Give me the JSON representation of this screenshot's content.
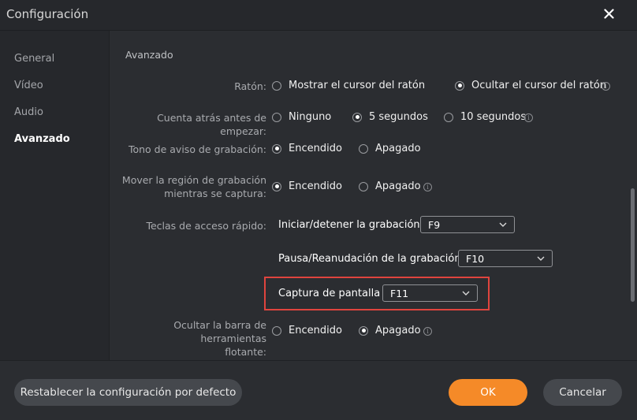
{
  "window": {
    "title": "Configuración"
  },
  "sidebar": {
    "items": [
      {
        "label": "General"
      },
      {
        "label": "Vídeo"
      },
      {
        "label": "Audio"
      },
      {
        "label": "Avanzado"
      }
    ],
    "active": "Avanzado"
  },
  "section": {
    "title": "Avanzado"
  },
  "settings": {
    "mouse": {
      "label": "Ratón:",
      "options": [
        "Mostrar el cursor del ratón",
        "Ocultar el cursor del ratón"
      ],
      "selected": "Ocultar el cursor del ratón"
    },
    "countdown": {
      "label": "Cuenta atrás antes de empezar:",
      "options": [
        "Ninguno",
        "5 segundos",
        "10 segundos"
      ],
      "selected": "5 segundos"
    },
    "beep": {
      "label": "Tono de aviso de grabación:",
      "options": [
        "Encendido",
        "Apagado"
      ],
      "selected": "Encendido"
    },
    "move_region": {
      "label_line1": "Mover la región de grabación",
      "label_line2": "mientras se captura:",
      "options": [
        "Encendido",
        "Apagado"
      ],
      "selected": "Encendido"
    },
    "hotkeys": {
      "label": "Teclas de acceso rápido:",
      "start_stop": {
        "label": "Iniciar/detener la grabación",
        "value": "F9"
      },
      "pause_resume": {
        "label": "Pausa/Reanudación de la grabación",
        "value": "F10"
      },
      "screenshot": {
        "label": "Captura de pantalla",
        "value": "F11"
      }
    },
    "hide_toolbar": {
      "label_line1": "Ocultar la barra de herramientas",
      "label_line2": "flotante:",
      "options": [
        "Encendido",
        "Apagado"
      ],
      "selected": "Apagado"
    }
  },
  "footer": {
    "reset_label": "Restablecer la configuración por defecto",
    "ok_label": "OK",
    "cancel_label": "Cancelar"
  },
  "colors": {
    "accent": "#f58a28",
    "highlight": "#e0443e",
    "background": "#2b2d31"
  },
  "icons": {
    "close": "close-icon",
    "info": "info-icon",
    "chevron": "chevron-down-icon"
  }
}
